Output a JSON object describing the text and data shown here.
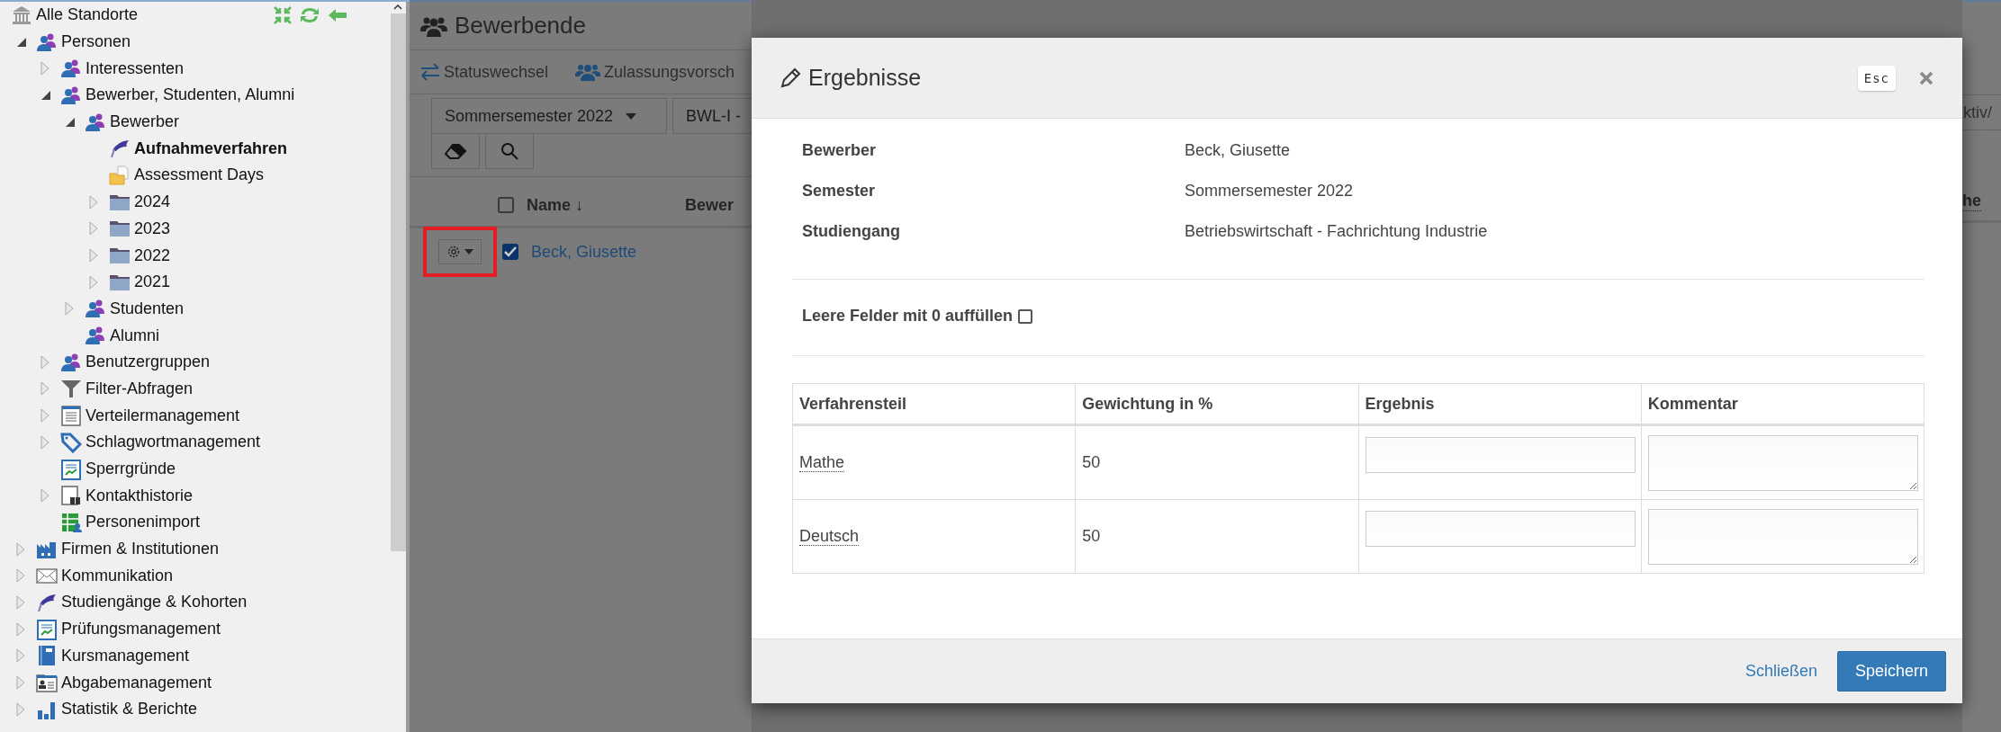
{
  "sidebar": {
    "tree": [
      {
        "label": "Alle Standorte",
        "kind": "bank",
        "selected": false,
        "children": [
          {
            "label": "Personen",
            "kind": "group",
            "expanded": true,
            "selected": false,
            "children": [
              {
                "label": "Interessenten",
                "kind": "group",
                "expanded": false,
                "selected": false
              },
              {
                "label": "Bewerber, Studenten, Alumni",
                "kind": "group",
                "expanded": true,
                "selected": false,
                "children": [
                  {
                    "label": "Bewerber",
                    "kind": "group",
                    "expanded": true,
                    "selected": false,
                    "children": [
                      {
                        "label": "Aufnahmeverfahren",
                        "kind": "cap",
                        "selected": true
                      },
                      {
                        "label": "Assessment Days",
                        "kind": "docfolder",
                        "selected": false
                      },
                      {
                        "label": "2024",
                        "kind": "folder",
                        "expanded": false,
                        "selected": false
                      },
                      {
                        "label": "2023",
                        "kind": "folder",
                        "expanded": false,
                        "selected": false
                      },
                      {
                        "label": "2022",
                        "kind": "folder",
                        "expanded": false,
                        "selected": false
                      },
                      {
                        "label": "2021",
                        "kind": "folder",
                        "expanded": false,
                        "selected": false
                      }
                    ]
                  },
                  {
                    "label": "Studenten",
                    "kind": "group",
                    "expanded": false,
                    "selected": false
                  },
                  {
                    "label": "Alumni",
                    "kind": "group",
                    "selected": false
                  }
                ]
              },
              {
                "label": "Benutzergruppen",
                "kind": "group",
                "expanded": false,
                "selected": false
              },
              {
                "label": "Filter-Abfragen",
                "kind": "filter",
                "expanded": false,
                "selected": false
              },
              {
                "label": "Verteilermanagement",
                "kind": "list",
                "expanded": false,
                "selected": false
              },
              {
                "label": "Schlagwortmanagement",
                "kind": "tag",
                "expanded": false,
                "selected": false
              },
              {
                "label": "Sperrgründe",
                "kind": "chartdoc",
                "selected": false
              },
              {
                "label": "Kontakthistorie",
                "kind": "binoc",
                "expanded": false,
                "selected": false
              },
              {
                "label": "Personenimport",
                "kind": "import",
                "selected": false
              }
            ]
          },
          {
            "label": "Firmen & Institutionen",
            "kind": "factory",
            "expanded": false,
            "selected": false
          },
          {
            "label": "Kommunikation",
            "kind": "mail",
            "expanded": false,
            "selected": false
          },
          {
            "label": "Studiengänge & Kohorten",
            "kind": "cap",
            "expanded": false,
            "selected": false
          },
          {
            "label": "Prüfungsmanagement",
            "kind": "chartdoc",
            "expanded": false,
            "selected": false
          },
          {
            "label": "Kursmanagement",
            "kind": "book",
            "expanded": false,
            "selected": false
          },
          {
            "label": "Abgabemanagement",
            "kind": "idcard",
            "expanded": false,
            "selected": false
          },
          {
            "label": "Statistik & Berichte",
            "kind": "bars",
            "expanded": false,
            "selected": false
          }
        ]
      }
    ]
  },
  "page": {
    "title": "Bewerbende",
    "toolbar": [
      {
        "label": "Statuswechsel",
        "kind": "switch"
      },
      {
        "label": "Zulassungsvorsch",
        "kind": "users"
      }
    ],
    "filters": [
      "Sommersemester 2022",
      "BWL-I -"
    ],
    "filter_right": "ktiv/",
    "table": {
      "all_checked": false,
      "columns": [
        "Name ↓",
        "Bewer"
      ],
      "column_right": "he",
      "rows": [
        {
          "name": "Beck, Giusette",
          "selected": true,
          "highlighted": true
        }
      ]
    }
  },
  "modal": {
    "title": "Ergebnisse",
    "esc": "Esc",
    "fields": [
      {
        "label": "Bewerber",
        "value": "Beck, Giusette"
      },
      {
        "label": "Semester",
        "value": "Sommersemester 2022"
      },
      {
        "label": "Studiengang",
        "value": "Betriebswirtschaft - Fachrichtung Industrie"
      }
    ],
    "fill_zeros": {
      "label": "Leere Felder mit 0 auffüllen",
      "checked": false
    },
    "table": {
      "columns": [
        "Verfahrensteil",
        "Gewichtung in %",
        "Ergebnis",
        "Kommentar"
      ],
      "rows": [
        {
          "part": "Mathe",
          "weight": "50"
        },
        {
          "part": "Deutsch",
          "weight": "50"
        }
      ]
    },
    "buttons": [
      {
        "label": "Schließen",
        "kind": "link"
      },
      {
        "label": "Speichern",
        "kind": "primary"
      }
    ]
  }
}
